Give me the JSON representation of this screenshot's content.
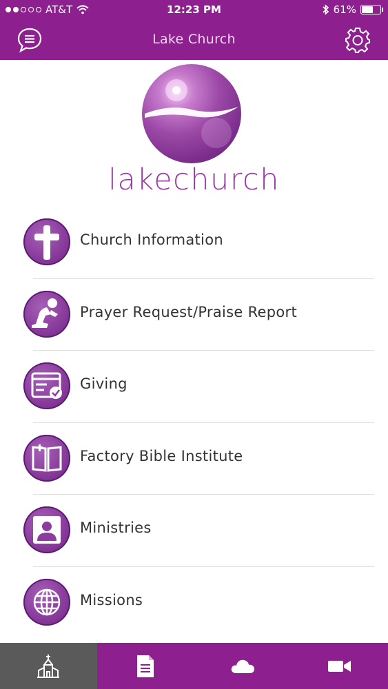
{
  "status": {
    "carrier": "AT&T",
    "time": "12:23 PM",
    "battery": "61%",
    "battery_level": 0.61
  },
  "nav": {
    "title": "Lake Church",
    "left_icon": "chat-icon",
    "right_icon": "gear-icon"
  },
  "logo": {
    "text": "lakechurch"
  },
  "menu": [
    {
      "label": "Church Information",
      "icon": "cross-icon"
    },
    {
      "label": "Prayer Request/Praise Report",
      "icon": "praying-person-icon"
    },
    {
      "label": "Giving",
      "icon": "giving-form-icon"
    },
    {
      "label": "Factory Bible Institute",
      "icon": "bible-icon"
    },
    {
      "label": "Ministries",
      "icon": "person-card-icon"
    },
    {
      "label": "Missions",
      "icon": "globe-icon"
    }
  ],
  "tabbar": [
    {
      "icon": "church-icon",
      "active": true
    },
    {
      "icon": "document-icon",
      "active": false
    },
    {
      "icon": "cloud-icon",
      "active": false
    },
    {
      "icon": "video-camera-icon",
      "active": false
    }
  ],
  "colors": {
    "primary": "#8e1f8f",
    "active_tab": "#5a5a5a",
    "logo_text": "#9a3aa6"
  }
}
